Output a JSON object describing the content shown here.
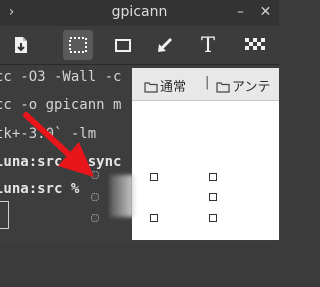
{
  "window": {
    "title": "gpicann"
  },
  "toolbar": {
    "tools": [
      {
        "name": "save-document-icon",
        "active": false
      },
      {
        "name": "rectangle-select-icon",
        "active": true
      },
      {
        "name": "rectangle-icon",
        "active": false
      },
      {
        "name": "arrow-icon",
        "active": false
      },
      {
        "name": "text-icon",
        "label": "T",
        "active": false
      },
      {
        "name": "blur-icon",
        "active": false
      }
    ],
    "text_tool_label": "T"
  },
  "terminal": {
    "lines": [
      "cc -O3 -Wall -c",
      "cc -o gpicann m",
      "tk+-3.0` -lm",
      "luna:src % sync",
      "luna:src %"
    ]
  },
  "breadcrumbs": {
    "items": [
      "通常",
      "アンテ"
    ],
    "separator": "|"
  },
  "colors": {
    "annotation_arrow": "#e8161b",
    "terminal_bg": "#3d3d3d",
    "titlebar_bg": "#333333"
  }
}
